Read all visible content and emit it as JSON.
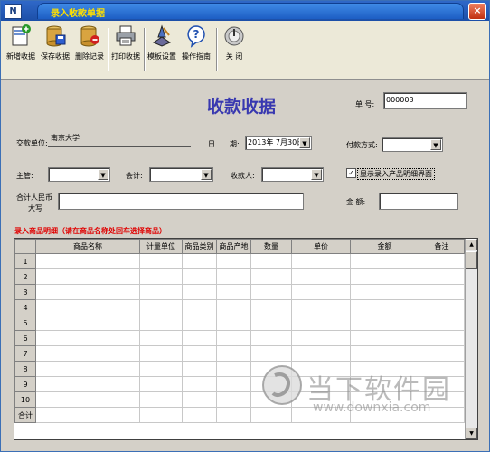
{
  "window": {
    "title": "录入收款单据",
    "sys_icon": "N",
    "close_label": "×"
  },
  "toolbar": {
    "buttons": [
      {
        "label": "新增收据",
        "icon": "new-doc-icon"
      },
      {
        "label": "保存收据",
        "icon": "save-icon"
      },
      {
        "label": "删除记录",
        "icon": "delete-icon"
      },
      {
        "label": "打印收据",
        "icon": "printer-icon"
      },
      {
        "label": "模板设置",
        "icon": "template-icon"
      },
      {
        "label": "操作指南",
        "icon": "help-icon"
      },
      {
        "label": "关  闭",
        "icon": "power-icon"
      }
    ]
  },
  "form": {
    "heading": "收款收据",
    "number_label": "单  号:",
    "number_value": "000003",
    "payer_label": "交款单位:",
    "payer_value": "南京大学",
    "date_label1": "日",
    "date_label2": "期:",
    "date_value": "2013年 7月30日",
    "payment_label": "付款方式:",
    "payment_value": "",
    "manager_label": "主管:",
    "manager_value": "",
    "accountant_label": "会计:",
    "accountant_value": "",
    "payee_label": "收款人:",
    "payee_value": "",
    "show_detail_label": "显示录入产品明细界面",
    "show_detail_checked": "✓",
    "rmb_label_line1": "合计人民币",
    "rmb_label_line2": "大写",
    "rmb_value": "",
    "amount_label": "金  额:",
    "amount_value": ""
  },
  "detail": {
    "title": "录入商品明细（请在商品名称处回车选择商品）",
    "columns": [
      "",
      "商品名称",
      "计量单位",
      "商品类别",
      "商品产地",
      "数量",
      "单价",
      "金额",
      "备注"
    ],
    "row_numbers": [
      "1",
      "2",
      "3",
      "4",
      "5",
      "6",
      "7",
      "8",
      "9",
      "10"
    ],
    "total_label": "合计"
  },
  "watermark": {
    "text": "当下软件园",
    "url": "www.downxia.com"
  },
  "colors": {
    "title_bar": "#1c4fa8",
    "title_text": "#ffe000",
    "heading": "#3838b0",
    "section": "#e00000"
  }
}
